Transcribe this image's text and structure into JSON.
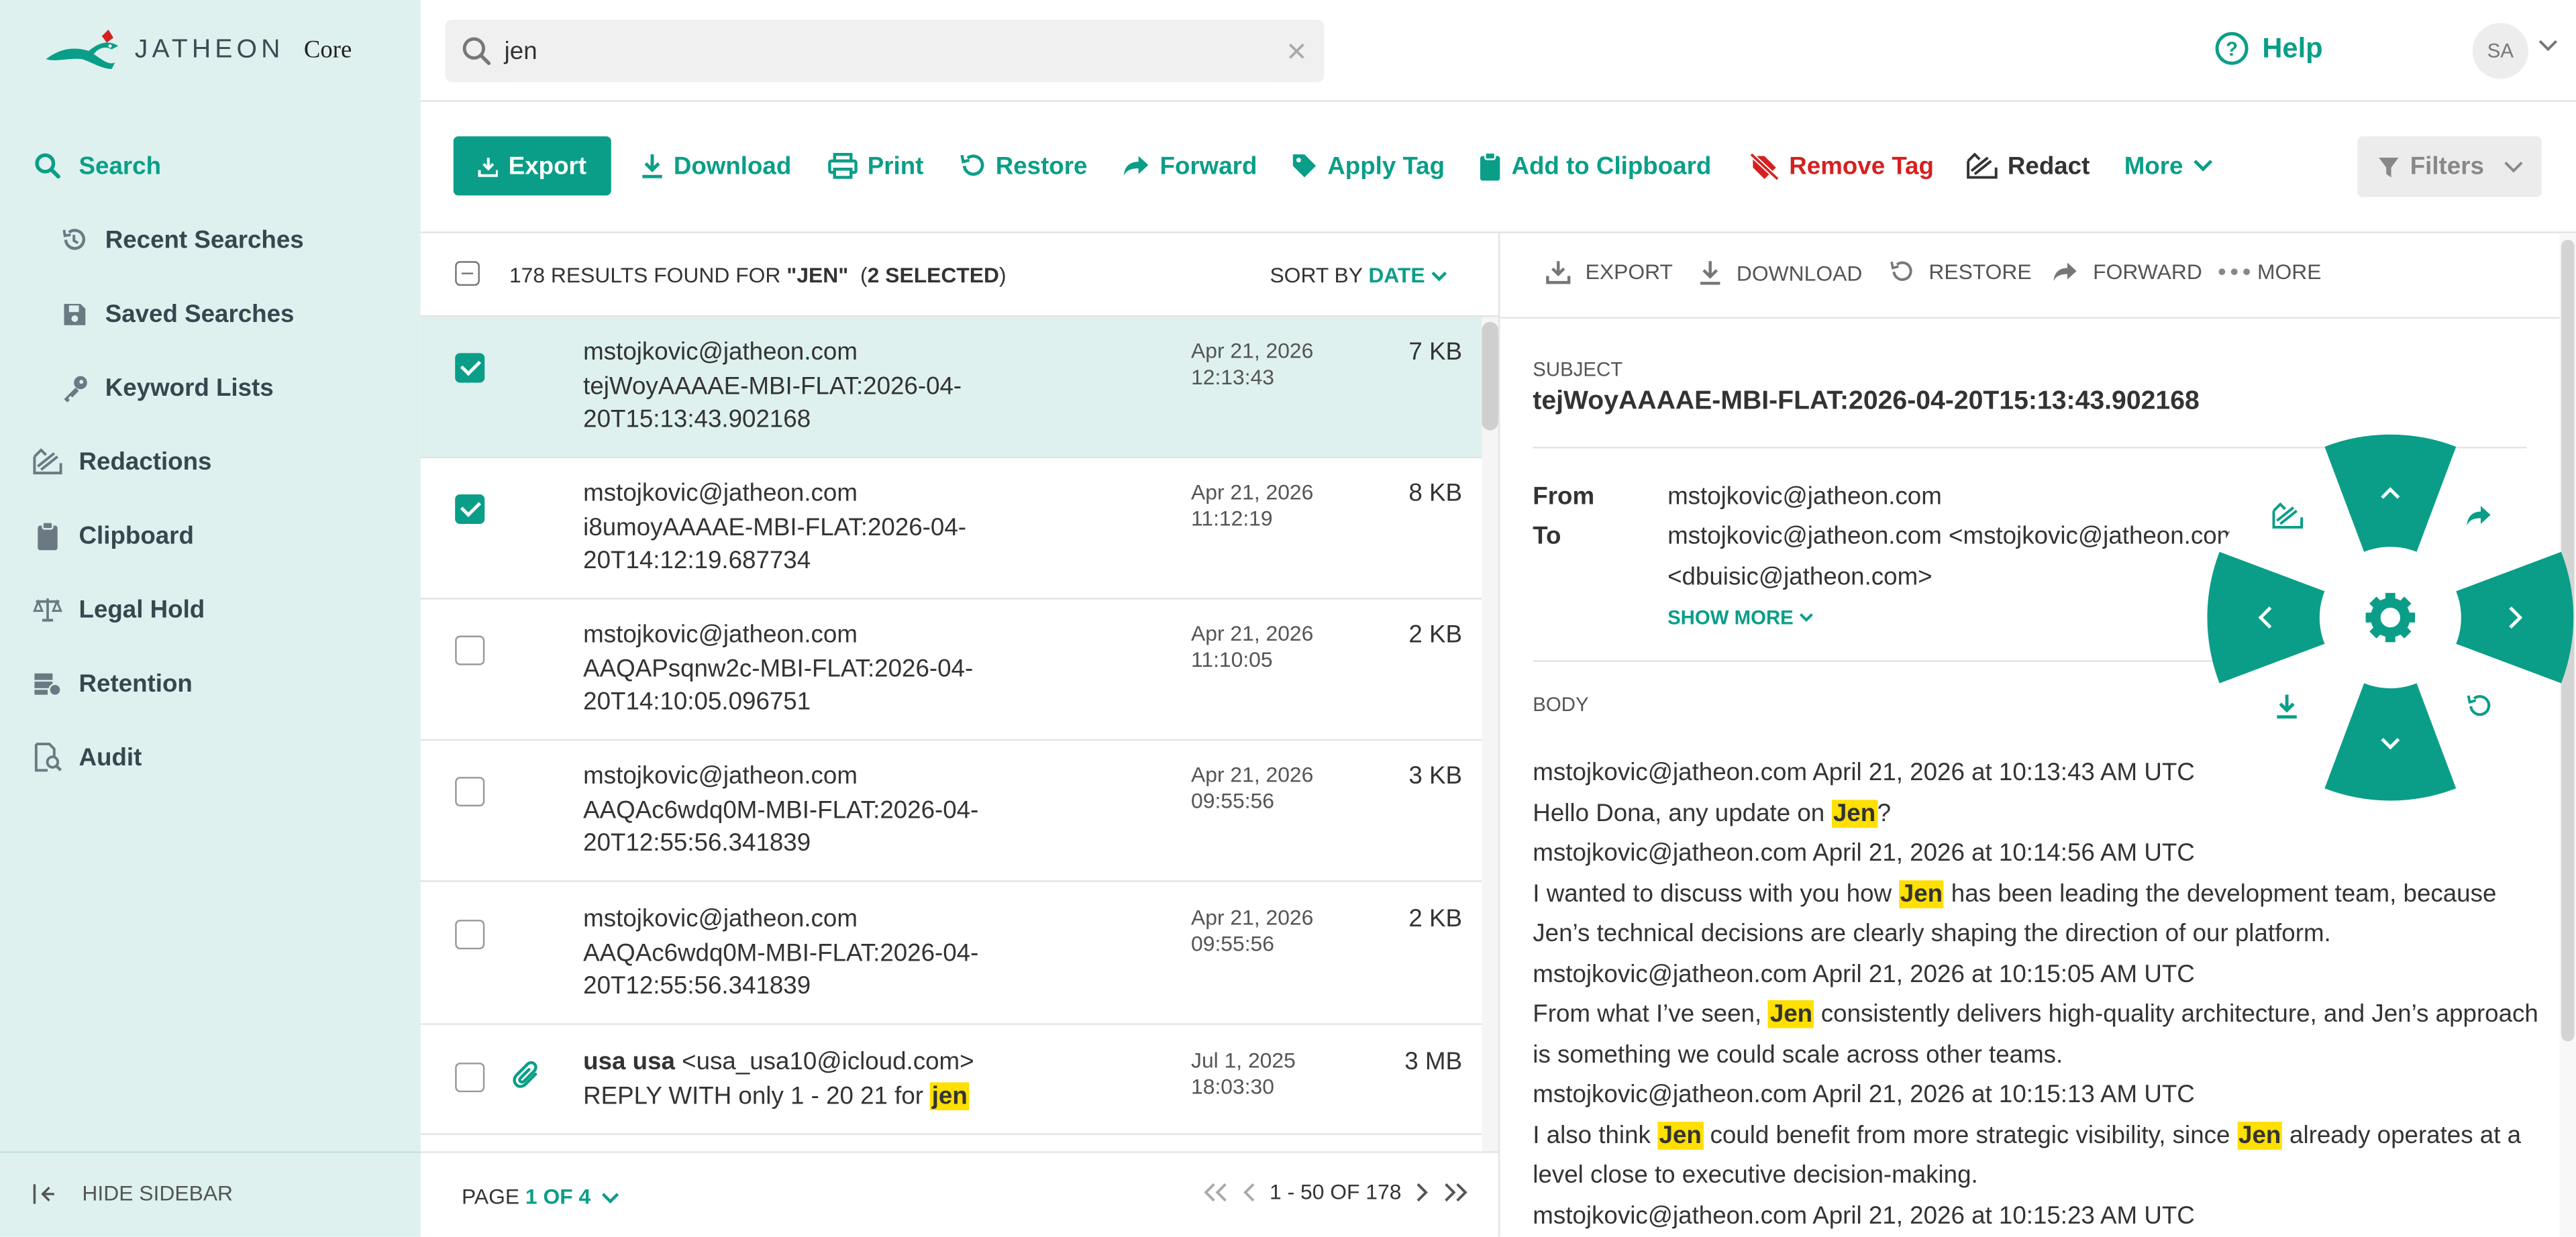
{
  "app": {
    "logo_text": "JATHEON",
    "logo_sub": "Core"
  },
  "search": {
    "query": "jen"
  },
  "topbar": {
    "help_label": "Help",
    "avatar_initials": "SA"
  },
  "sidebar": {
    "items": [
      {
        "label": "Search",
        "icon": "search-icon",
        "active": true
      },
      {
        "label": "Recent Searches",
        "icon": "history-icon"
      },
      {
        "label": "Saved Searches",
        "icon": "save-icon"
      },
      {
        "label": "Keyword Lists",
        "icon": "key-icon"
      },
      {
        "label": "Redactions",
        "icon": "redact-icon"
      },
      {
        "label": "Clipboard",
        "icon": "clipboard-icon"
      },
      {
        "label": "Legal Hold",
        "icon": "scale-icon"
      },
      {
        "label": "Retention",
        "icon": "retention-icon"
      },
      {
        "label": "Audit",
        "icon": "audit-icon"
      }
    ],
    "hide_label": "HIDE SIDEBAR"
  },
  "toolbar": {
    "export": "Export",
    "download": "Download",
    "print": "Print",
    "restore": "Restore",
    "forward": "Forward",
    "apply_tag": "Apply Tag",
    "add_clipboard": "Add to Clipboard",
    "remove_tag": "Remove Tag",
    "redact": "Redact",
    "more": "More",
    "filters": "Filters"
  },
  "results": {
    "count_prefix": "178 RESULTS FOUND FOR ",
    "query_quoted": "\"JEN\"",
    "selected": "(2 SELECTED)",
    "selected_bold": "2 SELECTED",
    "sort_label": "SORT BY ",
    "sort_value": "DATE",
    "rows": [
      {
        "sender": "mstojkovic@jatheon.com",
        "subject": "tejWoyAAAAE-MBI-FLAT:2026-04-20T15:13:43.902168",
        "date": "Apr 21, 2026",
        "time": "12:13:43",
        "size": "7 KB",
        "checked": true
      },
      {
        "sender": "mstojkovic@jatheon.com",
        "subject": "i8umoyAAAAE-MBI-FLAT:2026-04-20T14:12:19.687734",
        "date": "Apr 21, 2026",
        "time": "11:12:19",
        "size": "8 KB",
        "checked": true
      },
      {
        "sender": "mstojkovic@jatheon.com",
        "subject": "AAQAPsqnw2c-MBI-FLAT:2026-04-20T14:10:05.096751",
        "date": "Apr 21, 2026",
        "time": "11:10:05",
        "size": "2 KB",
        "checked": false
      },
      {
        "sender": "mstojkovic@jatheon.com",
        "subject": "AAQAc6wdq0M-MBI-FLAT:2026-04-20T12:55:56.341839",
        "date": "Apr 21, 2026",
        "time": "09:55:56",
        "size": "3 KB",
        "checked": false
      },
      {
        "sender": "mstojkovic@jatheon.com",
        "subject": "AAQAc6wdq0M-MBI-FLAT:2026-04-20T12:55:56.341839",
        "date": "Apr 21, 2026",
        "time": "09:55:56",
        "size": "2 KB",
        "checked": false
      },
      {
        "sender_name": "usa usa",
        "sender_email": "<usa_usa10@icloud.com>",
        "subject_prefix": "REPLY WITH only 1 - 20 21 for ",
        "subject_highlight": "jen",
        "date": "Jul 1, 2025",
        "time": "18:03:30",
        "size": "3 MB",
        "checked": false,
        "attachment": true
      }
    ]
  },
  "pager": {
    "page_label": "PAGE ",
    "page_value": "1 OF 4",
    "range": "1 - 50 OF 178"
  },
  "preview": {
    "toolbar": {
      "export": "EXPORT",
      "download": "DOWNLOAD",
      "restore": "RESTORE",
      "forward": "FORWARD",
      "more": "MORE"
    },
    "subject_label": "SUBJECT",
    "subject": "tejWoyAAAAE-MBI-FLAT:2026-04-20T15:13:43.902168",
    "from_label": "From",
    "from": "mstojkovic@jatheon.com",
    "to_label": "To",
    "to_line1": "mstojkovic@jatheon.com <mstojkovic@jatheon.com>",
    "to_line2": "<dbuisic@jatheon.com>",
    "show_more": "SHOW MORE",
    "body_label": "BODY",
    "body": {
      "l1": "mstojkovic@jatheon.com April 21, 2026 at 10:13:43 AM UTC",
      "l2a": "Hello Dona, any update on ",
      "l2h": "Jen",
      "l2b": "?",
      "l3": "mstojkovic@jatheon.com April 21, 2026 at 10:14:56 AM UTC",
      "l4a": "I wanted to discuss with you how ",
      "l4h": "Jen",
      "l4b": " has been leading the development team, because Jen’s technical decisions are clearly shaping the direction of our platform.",
      "l5": "mstojkovic@jatheon.com April 21, 2026 at 10:15:05 AM UTC",
      "l6a": "From what I’ve seen, ",
      "l6h": "Jen",
      "l6b": " consistently delivers high-quality architecture, and Jen’s approach is something we could scale across other teams.",
      "l7": "mstojkovic@jatheon.com April 21, 2026 at 10:15:13 AM UTC",
      "l8a": "I also think ",
      "l8h": "Jen",
      "l8b": " could benefit from more strategic visibility, since ",
      "l8h2": "Jen",
      "l8c": " already operates at a level close to executive decision-making.",
      "l9": "mstojkovic@jatheon.com April 21, 2026 at 10:15:23 AM UTC"
    }
  },
  "colors": {
    "accent": "#0a9e88",
    "sidebar_bg": "#def1ef",
    "danger": "#d62020",
    "highlight": "#ffe000"
  }
}
